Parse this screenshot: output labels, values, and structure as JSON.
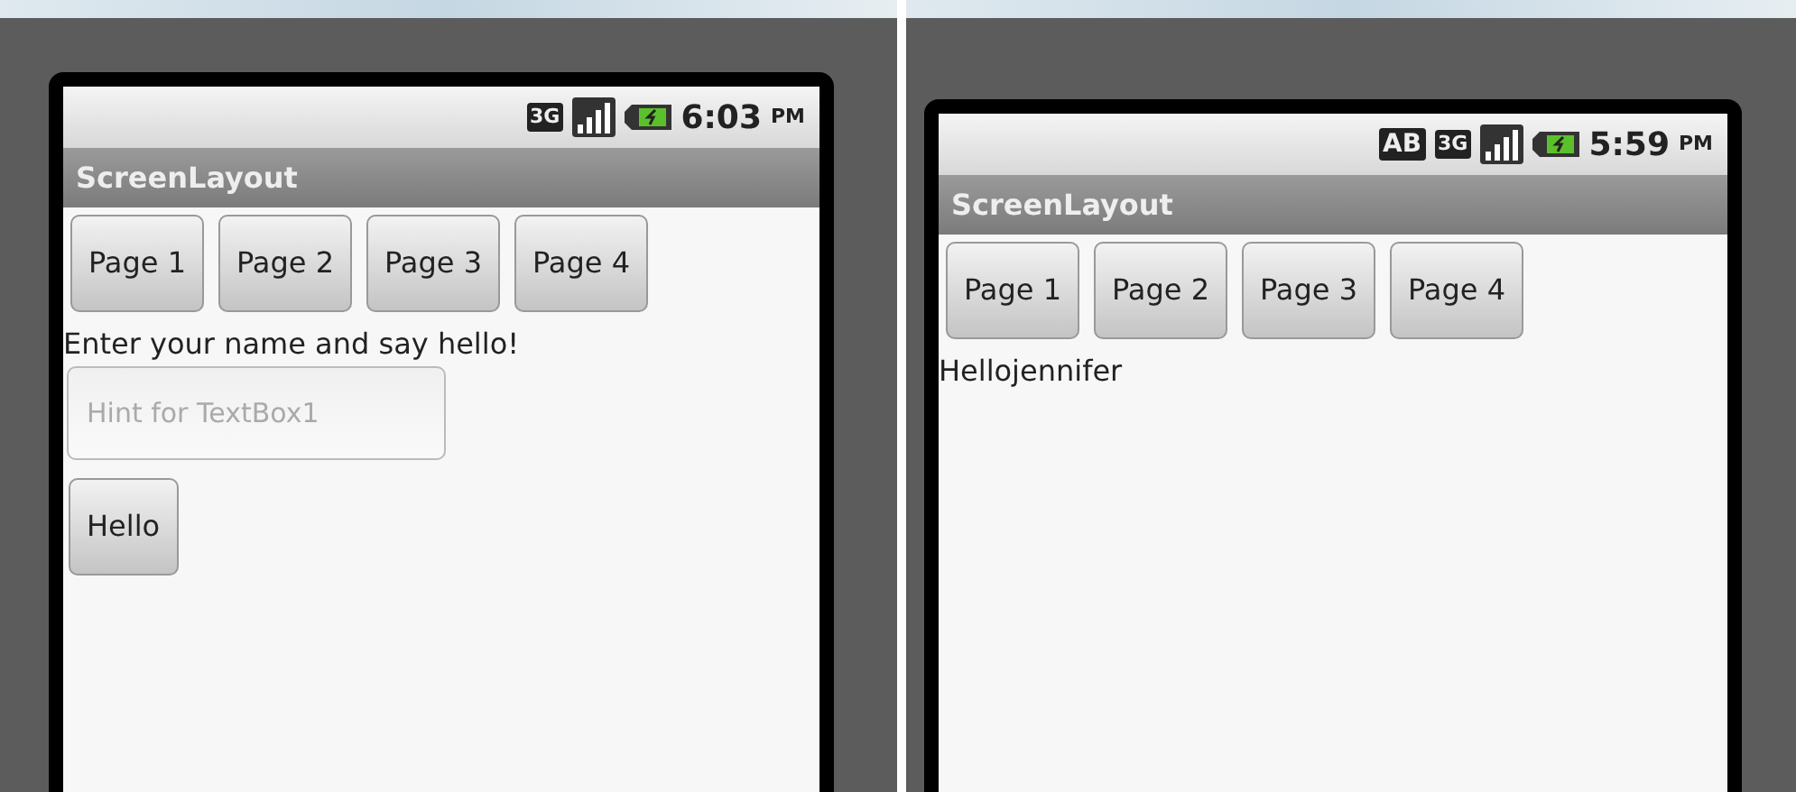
{
  "screens": [
    {
      "status_bar": {
        "network_type": "3G",
        "time": "6:03",
        "meridiem": "PM"
      },
      "title": "ScreenLayout",
      "page_buttons": [
        "Page 1",
        "Page 2",
        "Page 3",
        "Page 4"
      ],
      "content": [
        {
          "kind": "label",
          "text": "Enter your name and say hello!"
        },
        {
          "kind": "textbox",
          "placeholder": "Hint for TextBox1"
        },
        {
          "kind": "button",
          "label": "Hello"
        }
      ]
    },
    {
      "status_bar": {
        "notification": "AB",
        "network_type": "3G",
        "time": "5:59",
        "meridiem": "PM"
      },
      "title": "ScreenLayout",
      "page_buttons": [
        "Page 1",
        "Page 2",
        "Page 3",
        "Page 4"
      ],
      "content": [
        {
          "kind": "label",
          "text": "Hellojennifer"
        }
      ]
    }
  ]
}
